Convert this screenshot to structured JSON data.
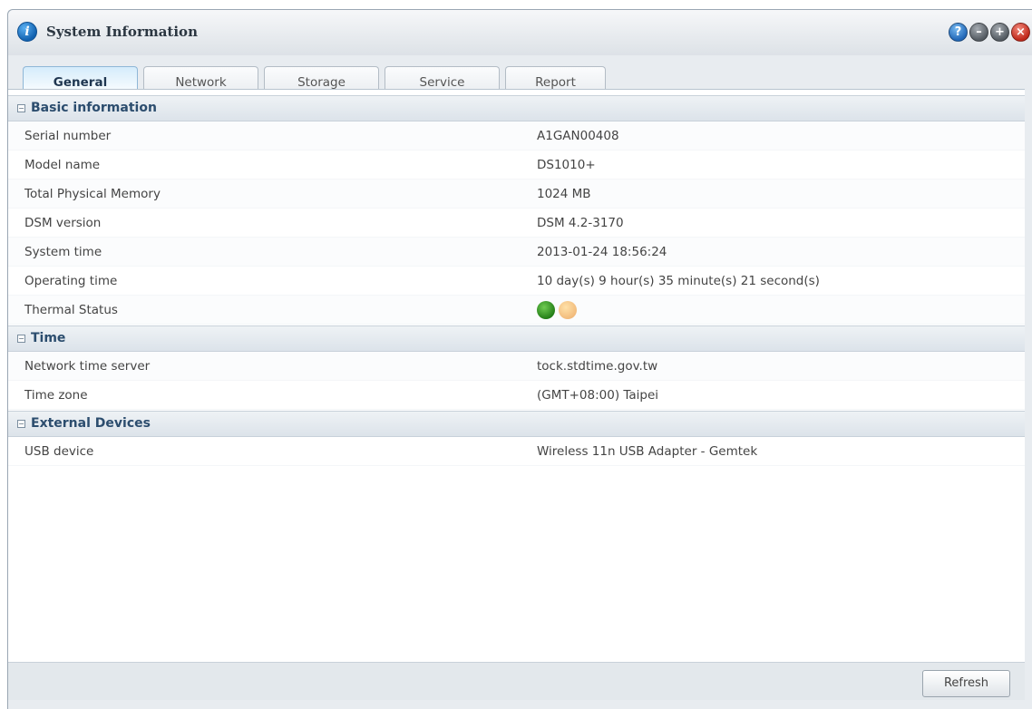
{
  "window": {
    "title": "System Information",
    "buttons": [
      {
        "name": "help-button",
        "glyph": "?"
      },
      {
        "name": "minimize-button",
        "glyph": "–"
      },
      {
        "name": "maximize-button",
        "glyph": "+"
      },
      {
        "name": "close-button",
        "glyph": "×"
      }
    ]
  },
  "tabs": [
    "General",
    "Network",
    "Storage",
    "Service",
    "Report"
  ],
  "active_tab": "General",
  "sections": {
    "basic": {
      "title": "Basic information",
      "rows": [
        {
          "label": "Serial number",
          "value": "A1GAN00408"
        },
        {
          "label": "Model name",
          "value": "DS1010+"
        },
        {
          "label": "Total Physical Memory",
          "value": "1024 MB"
        },
        {
          "label": "DSM version",
          "value": "DSM 4.2-3170"
        },
        {
          "label": "System time",
          "value": "2013-01-24 18:56:24"
        },
        {
          "label": "Operating time",
          "value": "10 day(s) 9 hour(s) 35 minute(s) 21 second(s)"
        },
        {
          "label": "Thermal Status"
        }
      ],
      "thermal": {
        "green_icon": "thermal-normal-icon",
        "amber_icon": "thermal-warning-icon"
      }
    },
    "time": {
      "title": "Time",
      "rows": [
        {
          "label": "Network time server",
          "value": "tock.stdtime.gov.tw"
        },
        {
          "label": "Time zone",
          "value": "(GMT+08:00) Taipei"
        }
      ]
    },
    "external": {
      "title": "External Devices",
      "rows": [
        {
          "label": "USB device",
          "value": "Wireless 11n USB Adapter - Gemtek"
        }
      ]
    }
  },
  "footer": {
    "refresh_label": "Refresh"
  },
  "colors": {
    "accent": "#2c4d6e",
    "active_tab_bg": "#d5ecfb",
    "status_green": "#1f7a14",
    "status_amber": "#f1b979"
  }
}
